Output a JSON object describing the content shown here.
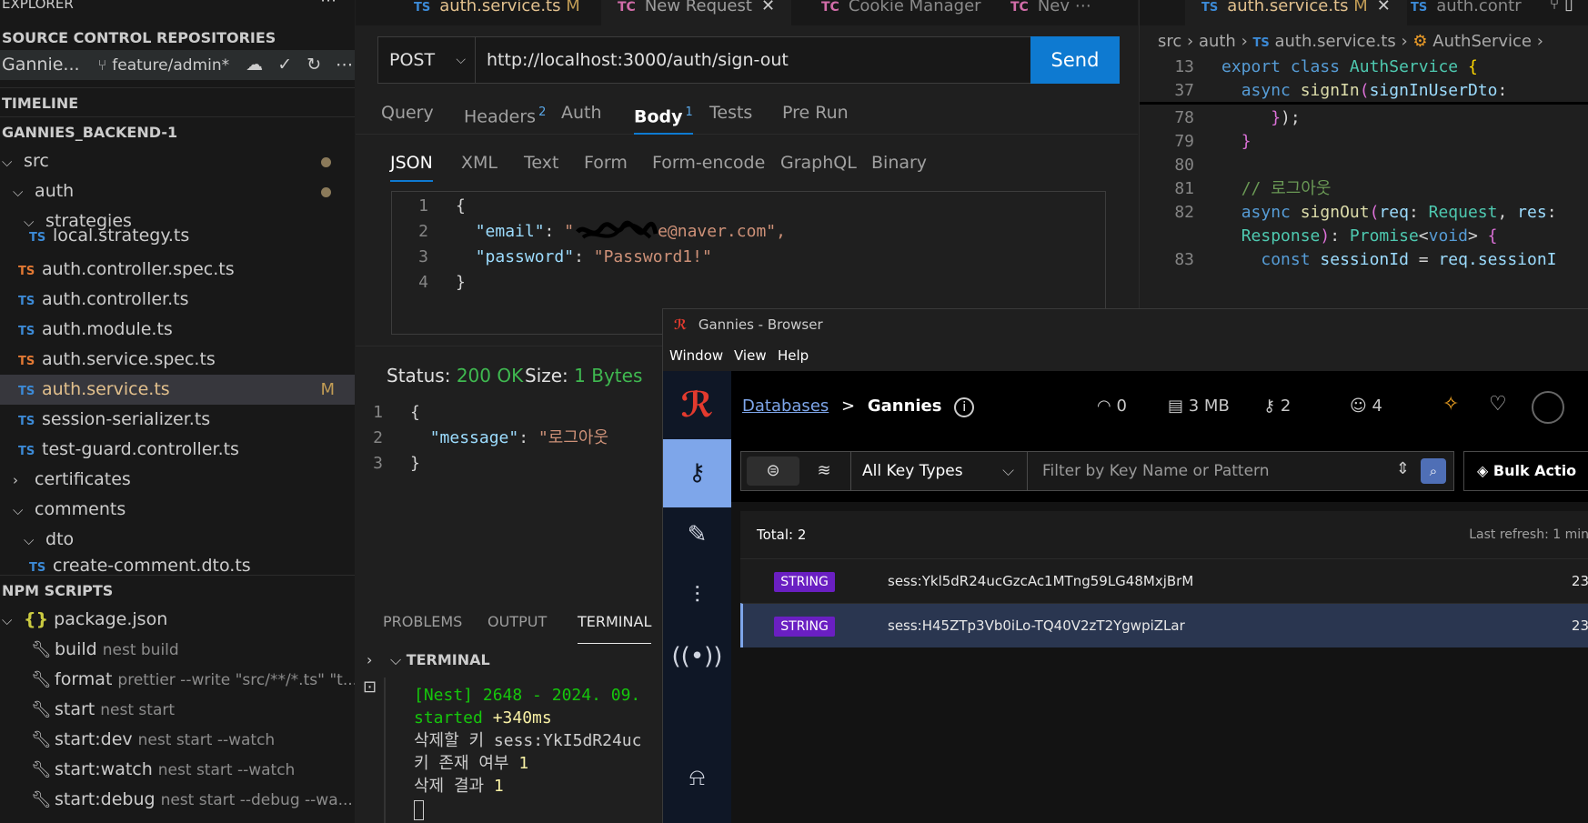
{
  "sidebar": {
    "explorer_title": "EXPLORER",
    "more_icon": "ellipsis-icon",
    "scm_title": "SOURCE CONTROL REPOSITORIES",
    "repo_name": "Gannie...",
    "branch": "feature/admin*",
    "timeline_title": "TIMELINE",
    "project_title": "GANNIES_BACKEND-1",
    "tree": [
      {
        "label": "src",
        "type": "folder-open",
        "indent": 0,
        "dot": true
      },
      {
        "label": "auth",
        "type": "folder-open",
        "indent": 1,
        "dot": true
      },
      {
        "label": "strategies",
        "type": "folder-open",
        "indent": 2
      },
      {
        "label": "local.strategy.ts",
        "type": "ts",
        "indent": 3
      },
      {
        "label": "auth.controller.spec.ts",
        "type": "spec",
        "indent": 2
      },
      {
        "label": "auth.controller.ts",
        "type": "ts",
        "indent": 2
      },
      {
        "label": "auth.module.ts",
        "type": "ts",
        "indent": 2
      },
      {
        "label": "auth.service.spec.ts",
        "type": "spec",
        "indent": 2
      },
      {
        "label": "auth.service.ts",
        "type": "ts",
        "indent": 2,
        "selected": true,
        "badge": "M"
      },
      {
        "label": "session-serializer.ts",
        "type": "ts",
        "indent": 2
      },
      {
        "label": "test-guard.controller.ts",
        "type": "ts",
        "indent": 2
      },
      {
        "label": "certificates",
        "type": "folder-closed",
        "indent": 1
      },
      {
        "label": "comments",
        "type": "folder-open",
        "indent": 1
      },
      {
        "label": "dto",
        "type": "folder-open",
        "indent": 2
      },
      {
        "label": "create-comment.dto.ts",
        "type": "ts",
        "indent": 3
      }
    ],
    "npm_title": "NPM SCRIPTS",
    "package_file": "package.json",
    "scripts": [
      {
        "name": "build",
        "cmd": "nest build"
      },
      {
        "name": "format",
        "cmd": "prettier --write \"src/**/*.ts\" \"t..."
      },
      {
        "name": "start",
        "cmd": "nest start"
      },
      {
        "name": "start:dev",
        "cmd": "nest start --watch"
      },
      {
        "name": "start:watch",
        "cmd": "nest start --watch"
      },
      {
        "name": "start:debug",
        "cmd": "nest start --debug --wa..."
      }
    ]
  },
  "api": {
    "tabs": [
      {
        "label": "auth.service.ts",
        "badge": "M",
        "icon": "TS"
      },
      {
        "label": "New Request",
        "icon": "TC",
        "active": true
      },
      {
        "label": "Cookie Manager",
        "icon": "TC"
      },
      {
        "label": "Nev",
        "icon": "TC"
      }
    ],
    "method": "POST",
    "url": "http://localhost:3000/auth/sign-out",
    "send_label": "Send",
    "request_tabs": [
      {
        "label": "Query"
      },
      {
        "label": "Headers",
        "count": "2"
      },
      {
        "label": "Auth"
      },
      {
        "label": "Body",
        "count": "1",
        "active": true
      },
      {
        "label": "Tests"
      },
      {
        "label": "Pre Run"
      }
    ],
    "body_tabs": [
      "JSON",
      "XML",
      "Text",
      "Form",
      "Form-encode",
      "GraphQL",
      "Binary"
    ],
    "body_lines": {
      "l1": "1",
      "l2": "2",
      "l3": "3",
      "l4": "4",
      "brace_open": "{",
      "email_key": "\"email\"",
      "email_val": "e@naver.com\",",
      "pass_key": "\"password\"",
      "pass_val": "\"Password1!\"",
      "brace_close": "}"
    },
    "status_label": "Status:",
    "status_value": "200 OK",
    "size_label": "Size:",
    "size_value": "1 Bytes",
    "response": {
      "l1": "1",
      "l2": "2",
      "l3": "3",
      "brace_open": "{",
      "message_key": "\"message\"",
      "message_val": "\"로그아웃",
      "brace_close": "}"
    },
    "panel_tabs": [
      "PROBLEMS",
      "OUTPUT",
      "TERMINAL"
    ],
    "terminal_title": "TERMINAL",
    "terminal": {
      "nest_tag": "[Nest] 2648",
      "date_text": " - 2024. 09.",
      "started": "started",
      "elapsed": "+340ms",
      "line3": "삭제할 키 sess:YkI5dR24uc",
      "line4_text": "키 존재 여부 ",
      "line4_val": "1",
      "line5_text": "삭제 결과 ",
      "line5_val": "1"
    }
  },
  "code": {
    "tabs": [
      {
        "label": "auth.service.ts",
        "badge": "M",
        "active": true
      },
      {
        "label": "auth.contr"
      }
    ],
    "crumbs": {
      "c1": "src",
      "c2": "auth",
      "c3": "auth.service.ts",
      "c4": "AuthService"
    },
    "lines": [
      {
        "num": "13"
      },
      {
        "num": "37"
      },
      {
        "num": "78"
      },
      {
        "num": "79"
      },
      {
        "num": "80"
      },
      {
        "num": "81"
      },
      {
        "num": "82"
      },
      {
        "num": "83"
      }
    ],
    "text": {
      "export": "export",
      "class": "class",
      "cls_name": "AuthService",
      "async": "async",
      "signin": "signIn",
      "signin_param": "signInUserDto",
      "close_paren": "});",
      "close_brace": "}",
      "comment": "// 로그아웃",
      "signout": "signOut",
      "req": "req",
      "request_type": "Request",
      "res": "res",
      "response_type": "Response",
      "promise": "Promise",
      "void": "void",
      "const": "const",
      "session_id": "sessionId",
      "req_session": "req.sessionI"
    }
  },
  "browser": {
    "title": "Gannies - Browser",
    "menu": [
      "Window",
      "View",
      "Help"
    ],
    "breadcrumb_link": "Databases",
    "breadcrumb_sep": ">",
    "db_name": "Gannies",
    "stats": {
      "ops": "0",
      "memory": "3 MB",
      "keys": "2",
      "clients": "4"
    },
    "key_type": "All Key Types",
    "filter_placeholder": "Filter by Key Name or Pattern",
    "bulk_label": "Bulk Actio",
    "total": "Total: 2",
    "last_refresh": "Last refresh: 1 min",
    "keys": [
      {
        "type": "STRING",
        "name": "sess:Ykl5dR24ucGzcAc1MTng59LG48MxjBrM",
        "ttl": "23"
      },
      {
        "type": "STRING",
        "name": "sess:H45ZTp3Vb0iLo-TQ40V2zT2YgwpiZLar",
        "ttl": "23",
        "selected": true
      }
    ]
  }
}
